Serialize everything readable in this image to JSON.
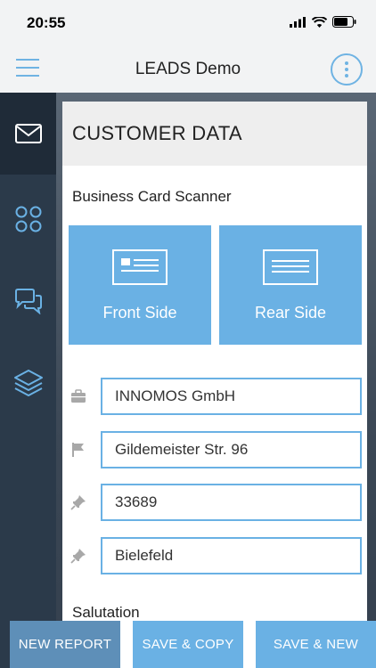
{
  "status": {
    "time": "20:55"
  },
  "header": {
    "title": "LEADS Demo"
  },
  "sidebar": {
    "items": [
      {
        "icon": "mail-icon",
        "active": true
      },
      {
        "icon": "grid-icon",
        "active": false
      },
      {
        "icon": "chat-icon",
        "active": false
      },
      {
        "icon": "layers-icon",
        "active": false
      }
    ]
  },
  "card": {
    "title": "CUSTOMER DATA",
    "scanner_label": "Business Card Scanner",
    "front_label": "Front Side",
    "rear_label": "Rear Side",
    "fields": {
      "company": "INNOMOS GmbH",
      "street": "Gildemeister Str. 96",
      "zip": "33689",
      "city": "Bielefeld"
    },
    "salutation_label": "Salutation"
  },
  "buttons": {
    "new_report": "NEW REPORT",
    "save_copy": "SAVE & COPY",
    "save_new": "SAVE & NEW"
  },
  "colors": {
    "accent": "#6ab1e4",
    "sidebar": "#2b3a4a"
  }
}
